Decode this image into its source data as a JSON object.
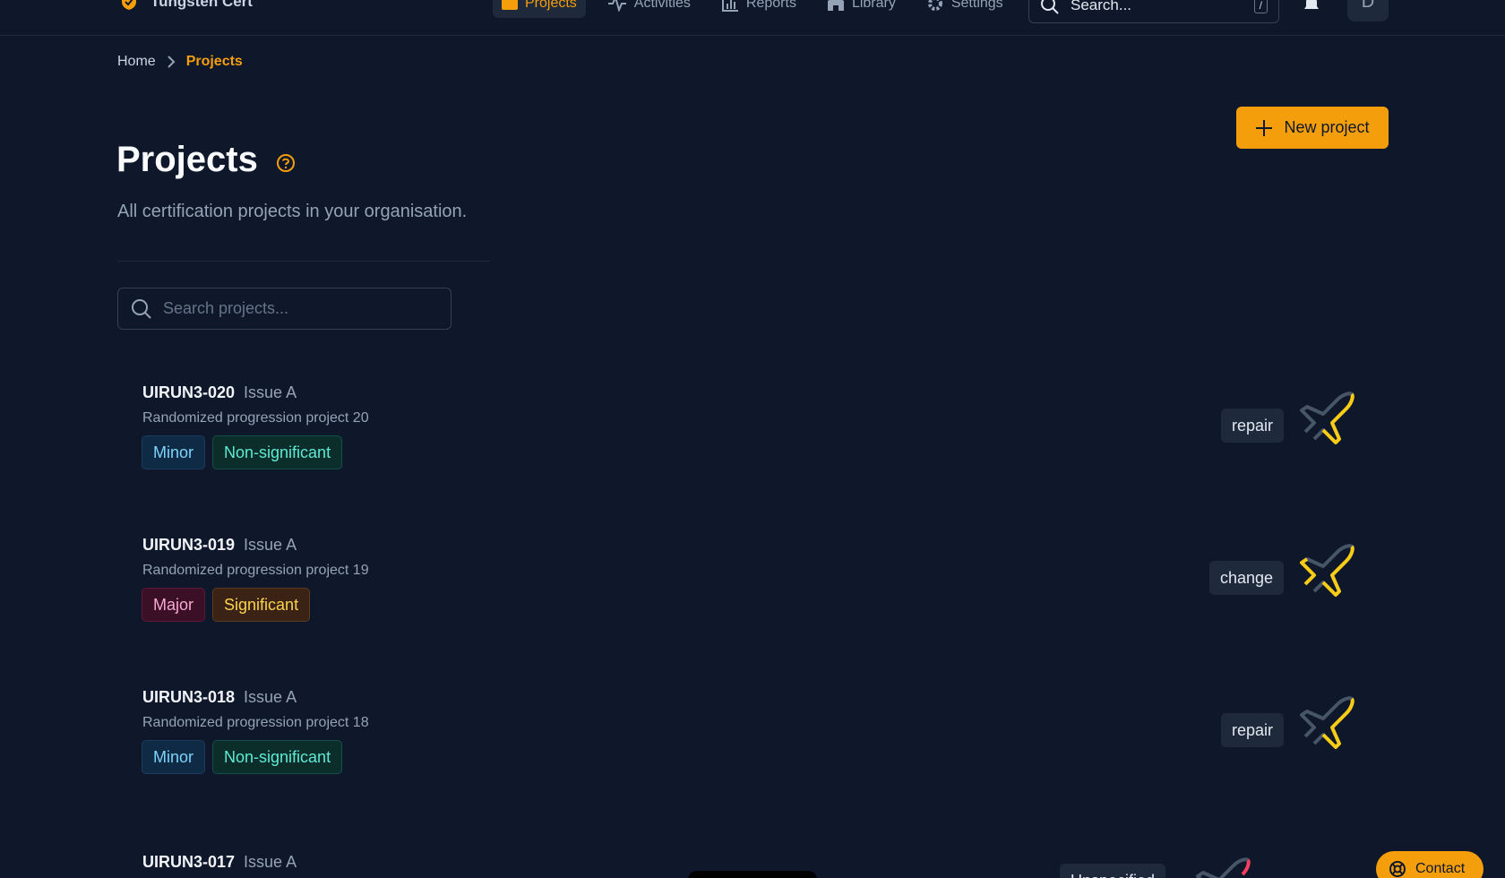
{
  "app": {
    "brand": "Tungsten Cert",
    "avatar_initial": "D"
  },
  "nav": [
    {
      "label": "Projects",
      "icon": "folder-icon",
      "active": true
    },
    {
      "label": "Activities",
      "icon": "activity-icon",
      "active": false
    },
    {
      "label": "Reports",
      "icon": "bar-chart-icon",
      "active": false
    },
    {
      "label": "Library",
      "icon": "library-icon",
      "active": false
    },
    {
      "label": "Settings",
      "icon": "gear-icon",
      "active": false
    }
  ],
  "global_search": {
    "placeholder": "Search...",
    "shortcut": "/"
  },
  "breadcrumb": {
    "home": "Home",
    "current": "Projects"
  },
  "header": {
    "title": "Projects",
    "subtitle": "All certification projects in your organisation.",
    "new_button": "New project"
  },
  "project_search": {
    "placeholder": "Search projects..."
  },
  "projects": [
    {
      "id": "UIRUN3-020",
      "issue": "Issue A",
      "description": "Randomized progression project 20",
      "badges": [
        {
          "label": "Minor",
          "kind": "minor"
        },
        {
          "label": "Non-significant",
          "kind": "nonsig"
        }
      ],
      "type": "repair"
    },
    {
      "id": "UIRUN3-019",
      "issue": "Issue A",
      "description": "Randomized progression project 19",
      "badges": [
        {
          "label": "Major",
          "kind": "major"
        },
        {
          "label": "Significant",
          "kind": "sig"
        }
      ],
      "type": "change"
    },
    {
      "id": "UIRUN3-018",
      "issue": "Issue A",
      "description": "Randomized progression project 18",
      "badges": [
        {
          "label": "Minor",
          "kind": "minor"
        },
        {
          "label": "Non-significant",
          "kind": "nonsig"
        }
      ],
      "type": "repair"
    },
    {
      "id": "UIRUN3-017",
      "issue": "Issue A",
      "description": "",
      "badges": [],
      "type": "Unspecified"
    }
  ],
  "contact": "Contact",
  "colors": {
    "accent": "#f59e0b",
    "background": "#0f172a",
    "plane_highlight": "#facc15",
    "plane_alert": "#f43f5e"
  }
}
